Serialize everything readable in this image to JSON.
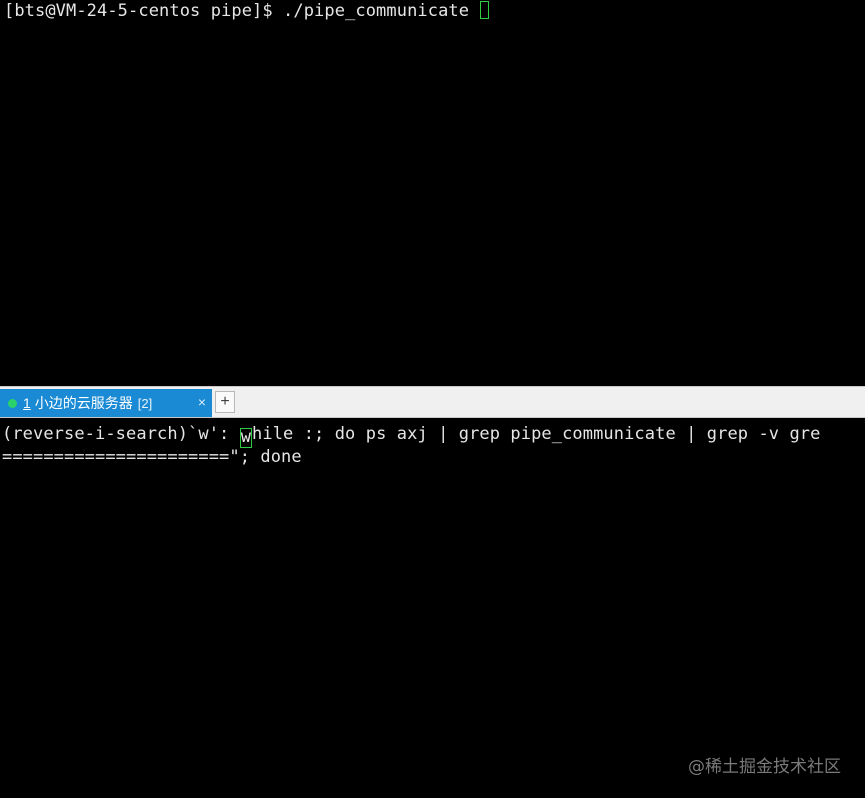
{
  "top_pane": {
    "prompt": "[bts@VM-24-5-centos pipe]$ ",
    "command": "./pipe_communicate "
  },
  "tab_bar": {
    "active_tab": {
      "index": "1",
      "title": "小边的云服务器",
      "count": "[2]",
      "close_icon": "×"
    },
    "add_tab_icon": "+"
  },
  "bottom_pane": {
    "search_prefix": "(reverse-i-search)`w': ",
    "match_char": "w",
    "line1_rest": "hile :; do ps axj | grep pipe_communicate | grep -v gre",
    "line2": "======================\"; done"
  },
  "watermark": "@稀土掘金技术社区",
  "colors": {
    "background": "#000000",
    "text": "#e6e6e6",
    "cursor": "#2ecc40",
    "tab_active": "#1a8ad4",
    "status_dot": "#2bd16a"
  }
}
